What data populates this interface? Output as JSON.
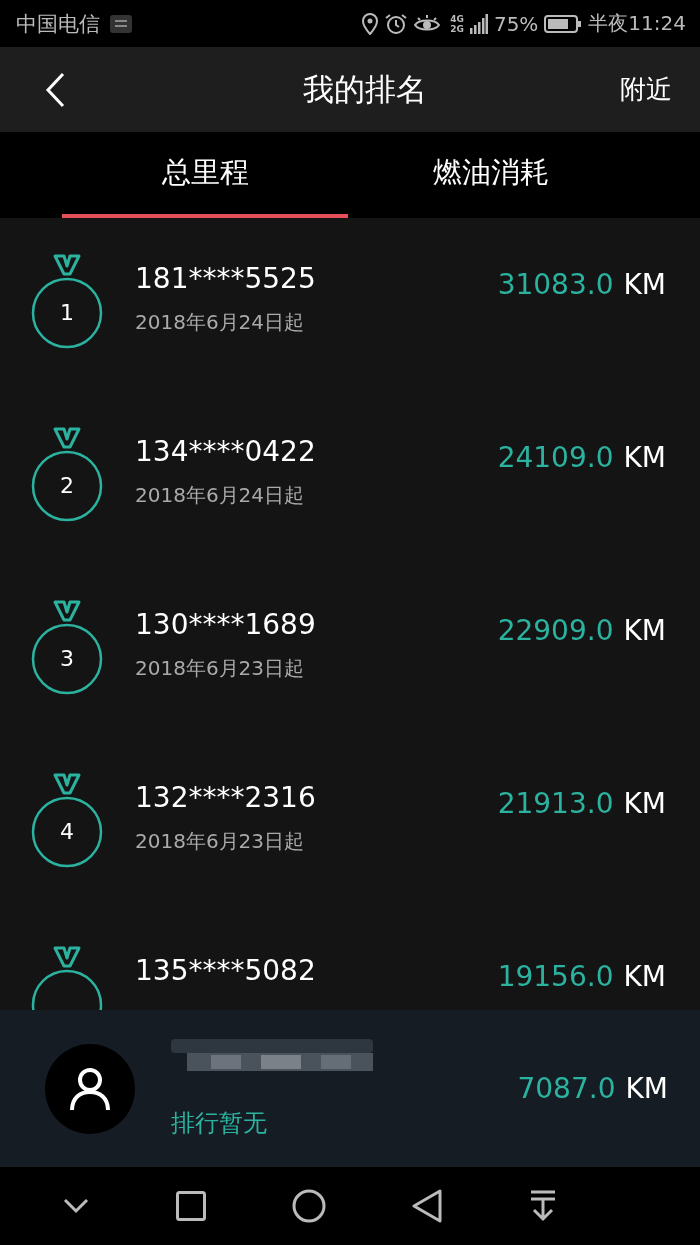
{
  "status_bar": {
    "carrier": "中国电信",
    "network_top": "4G",
    "network_bottom": "2G",
    "battery": "75%",
    "time": "半夜11:24"
  },
  "header": {
    "title": "我的排名",
    "action": "附近"
  },
  "tabs": [
    {
      "label": "总里程",
      "selected": true
    },
    {
      "label": "燃油消耗",
      "selected": false
    }
  ],
  "ranking": [
    {
      "rank": "1",
      "phone": "181****5525",
      "since": "2018年6月24日起",
      "distance": "31083.0",
      "unit": "KM"
    },
    {
      "rank": "2",
      "phone": "134****0422",
      "since": "2018年6月24日起",
      "distance": "24109.0",
      "unit": "KM"
    },
    {
      "rank": "3",
      "phone": "130****1689",
      "since": "2018年6月23日起",
      "distance": "22909.0",
      "unit": "KM"
    },
    {
      "rank": "4",
      "phone": "132****2316",
      "since": "2018年6月23日起",
      "distance": "21913.0",
      "unit": "KM"
    },
    {
      "phone": "135****5082",
      "distance": "19156.0",
      "unit": "KM"
    }
  ],
  "my_rank": {
    "status": "排行暂无",
    "distance": "7087.0",
    "unit": "KM"
  }
}
